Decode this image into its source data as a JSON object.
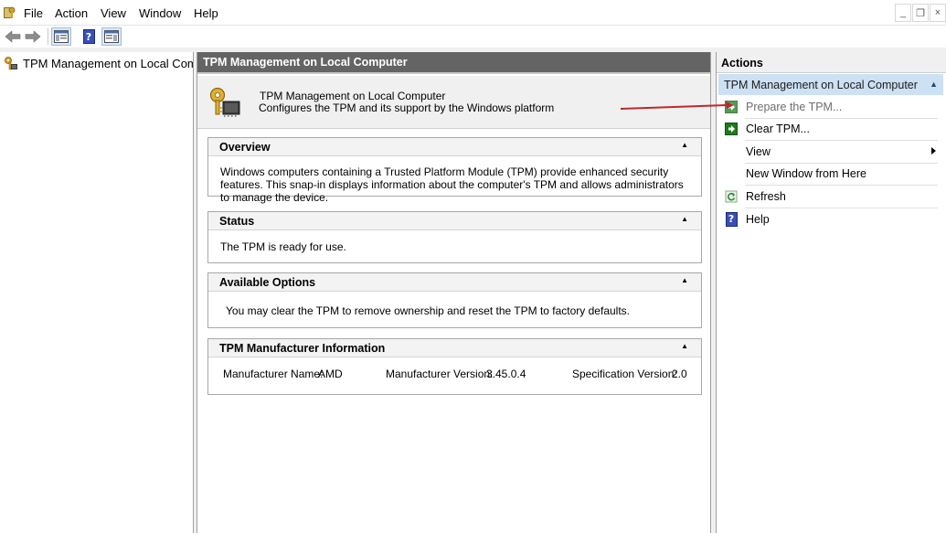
{
  "menu": {
    "items": [
      "File",
      "Action",
      "View",
      "Window",
      "Help"
    ]
  },
  "window_controls": {
    "minimize": "_",
    "restore": "❐",
    "close": "×"
  },
  "toolbar": {
    "icons": [
      "back-icon",
      "forward-icon",
      "show-hide-console-tree-icon",
      "help-icon",
      "show-hide-action-pane-icon"
    ]
  },
  "tree": {
    "root_label": "TPM Management on Local Computer"
  },
  "center": {
    "header": "TPM Management on Local Computer",
    "banner_title": "TPM Management on Local Computer",
    "banner_desc": "Configures the TPM and its support by the Windows platform",
    "sections": {
      "overview": {
        "title": "Overview",
        "text": "Windows computers containing a Trusted Platform Module (TPM) provide enhanced security features. This snap-in displays information about the computer's TPM and allows administrators to manage the device."
      },
      "status": {
        "title": "Status",
        "text": "The TPM is ready for use."
      },
      "options": {
        "title": "Available Options",
        "text": "You may clear the TPM to remove ownership and reset the TPM to factory defaults."
      },
      "manufacturer": {
        "title": "TPM Manufacturer Information",
        "name_label": "Manufacturer Name:",
        "name_value": "AMD",
        "version_label": "Manufacturer Version:",
        "version_value": "3.45.0.4",
        "spec_label": "Specification Version:",
        "spec_value": "2.0"
      }
    }
  },
  "actions": {
    "header": "Actions",
    "group": "TPM Management on Local Computer",
    "items": [
      {
        "label": "Prepare the TPM...",
        "icon": "green-arrow-icon",
        "enabled": false
      },
      {
        "label": "Clear TPM...",
        "icon": "green-arrow-icon",
        "enabled": true
      },
      {
        "label": "View",
        "icon": "",
        "enabled": true,
        "submenu": true
      },
      {
        "label": "New Window from Here",
        "icon": "",
        "enabled": true
      },
      {
        "label": "Refresh",
        "icon": "refresh-icon",
        "enabled": true
      },
      {
        "label": "Help",
        "icon": "help-icon",
        "enabled": true
      }
    ]
  },
  "colors": {
    "annotation_arrow": "#c0282a",
    "center_header": "#646464",
    "actions_group_bg": "#cde0f4"
  }
}
